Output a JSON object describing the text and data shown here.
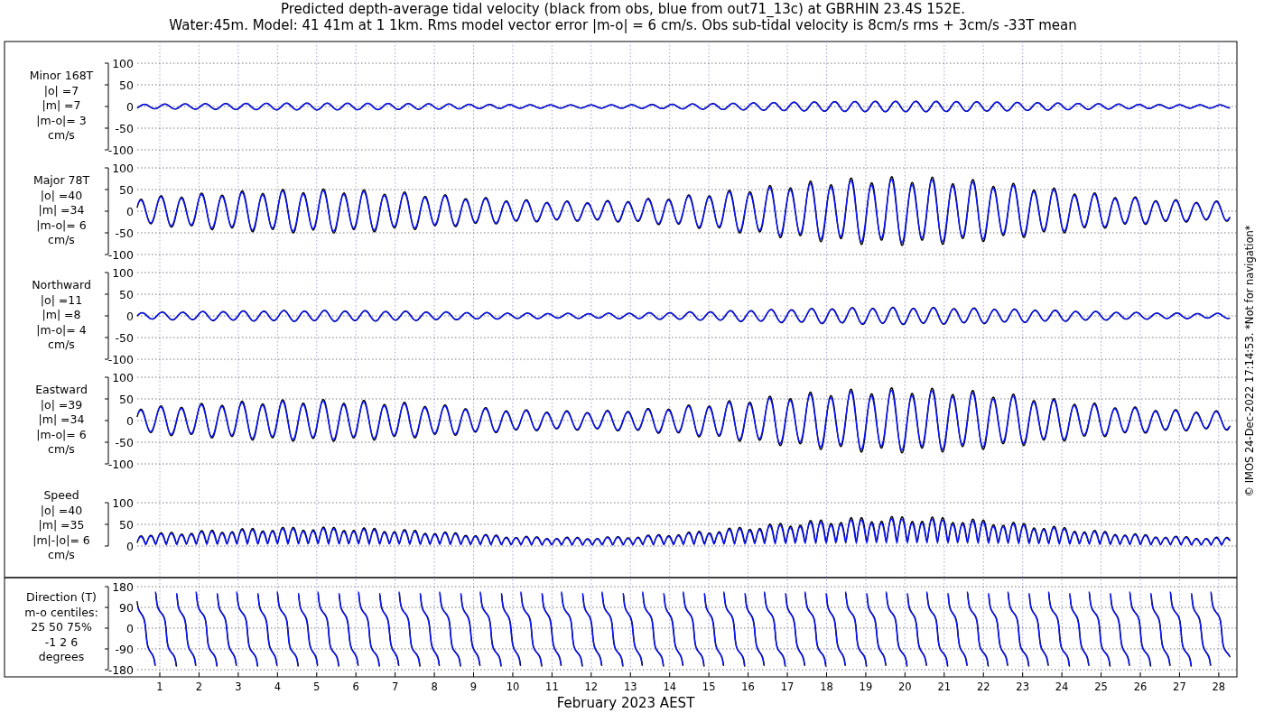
{
  "title_lines": [
    "Predicted depth-average tidal velocity (black from obs, blue from out71_13c) at GBRHIN 23.4S 152E.",
    "Water:45m. Model: 41 41m at 1 1km. Rms model vector error |m-o| = 6 cm/s. Obs sub-tidal velocity is 8cm/s rms + 3cm/s -33T mean"
  ],
  "panels": [
    {
      "kind": "component",
      "labels": [
        "Minor 168T",
        "|o| =7",
        "|m| =7",
        "|m-o|= 3",
        "cm/s"
      ],
      "yticks": [
        "100",
        "50",
        "0",
        "-50",
        "-100"
      ]
    },
    {
      "kind": "component",
      "labels": [
        "Major 78T",
        "|o| =40",
        "|m| =34",
        "|m-o|= 6",
        "cm/s"
      ],
      "yticks": [
        "100",
        "50",
        "0",
        "-50",
        "-100"
      ]
    },
    {
      "kind": "component",
      "labels": [
        "Northward",
        "|o| =11",
        "|m| =8",
        "|m-o|= 4",
        "cm/s"
      ],
      "yticks": [
        "100",
        "50",
        "0",
        "-50",
        "-100"
      ]
    },
    {
      "kind": "component",
      "labels": [
        "Eastward",
        "|o| =39",
        "|m| =34",
        "|m-o|= 6",
        "cm/s"
      ],
      "yticks": [
        "100",
        "50",
        "0",
        "-50",
        "-100"
      ]
    },
    {
      "kind": "speed",
      "labels": [
        "Speed",
        "|o| =40",
        "|m| =35",
        "|m|-|o|= 6",
        "cm/s"
      ],
      "yticks": [
        "100",
        "50",
        "0"
      ]
    },
    {
      "kind": "direction",
      "labels": [
        "Direction (T)",
        "m-o centiles:",
        "25  50  75%",
        "-1  2  6",
        "degrees"
      ],
      "yticks": [
        "180",
        "90",
        "0",
        "-90",
        "-180"
      ]
    }
  ],
  "x_axis": {
    "ticks": [
      "1",
      "2",
      "3",
      "4",
      "5",
      "6",
      "7",
      "8",
      "9",
      "10",
      "11",
      "12",
      "13",
      "14",
      "15",
      "16",
      "17",
      "18",
      "19",
      "20",
      "21",
      "22",
      "23",
      "24",
      "25",
      "26",
      "27",
      "28"
    ],
    "label": "February 2023 AEST"
  },
  "side_note": "© IMOS 24-Dec-2022 17:14:53.  *Not for navigation*"
}
